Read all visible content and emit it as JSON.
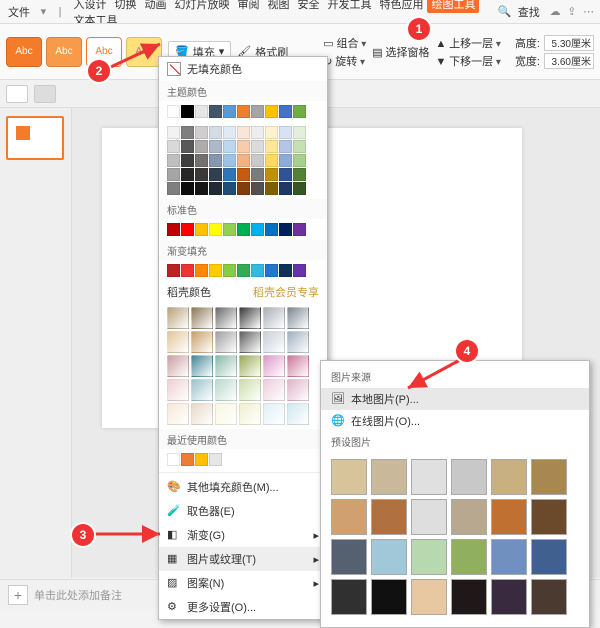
{
  "menu": {
    "file": "文件",
    "items": [
      "入设计",
      "切换",
      "动画",
      "幻灯片放映",
      "审阅",
      "视图",
      "安全",
      "开发工具",
      "特色应用",
      "绘图工具",
      "文本工具"
    ],
    "highlight_index": 9,
    "find": "查找"
  },
  "ribbon": {
    "abc": "Abc",
    "fill_label": "填充",
    "format_painter": "格式刷",
    "group": "组合",
    "rotate": "旋转",
    "select_pane": "选择窗格",
    "move_up": "上移一层",
    "move_down": "下移一层",
    "height_label": "高度:",
    "width_label": "宽度:",
    "height_value": "5.30厘米",
    "width_value": "3.60厘米"
  },
  "fillmenu": {
    "no_fill": "无填充颜色",
    "theme": "主题颜色",
    "std": "标准色",
    "grad": "渐变填充",
    "dk": "稻壳颜色",
    "dk_vip": "稻壳会员专享",
    "recent": "最近使用颜色",
    "items": {
      "more": "其他填充颜色(M)...",
      "picker": "取色器(E)",
      "gradient": "渐变(G)",
      "texture": "图片或纹理(T)",
      "pattern": "图案(N)",
      "more_settings": "更多设置(O)..."
    }
  },
  "imgsrc": {
    "src": "图片来源",
    "local": "本地图片(P)...",
    "online": "在线图片(O)...",
    "preset": "预设图片"
  },
  "bottom": {
    "hint": "单击此处添加备注"
  },
  "callouts": {
    "c1": "1",
    "c2": "2",
    "c3": "3",
    "c4": "4"
  },
  "colors": {
    "theme_row0": [
      "#ffffff",
      "#000000",
      "#e7e6e6",
      "#44546a",
      "#5b9bd5",
      "#ed7d31",
      "#a5a5a5",
      "#ffc000",
      "#4472c4",
      "#70ad47"
    ],
    "theme_shades": [
      [
        "#f2f2f2",
        "#7f7f7f",
        "#d0cece",
        "#d6dce5",
        "#deebf7",
        "#fbe5d6",
        "#ededed",
        "#fff2cc",
        "#d9e2f3",
        "#e2efda"
      ],
      [
        "#d9d9d9",
        "#595959",
        "#aeabab",
        "#adb9ca",
        "#bdd7ee",
        "#f7cbac",
        "#dbdbdb",
        "#ffe699",
        "#b4c6e7",
        "#c5e0b3"
      ],
      [
        "#bfbfbf",
        "#3f3f3f",
        "#757070",
        "#8496b0",
        "#9cc3e6",
        "#f4b183",
        "#c9c9c9",
        "#ffd965",
        "#8eaadb",
        "#a8d08d"
      ],
      [
        "#a5a5a5",
        "#262626",
        "#3a3838",
        "#323f4f",
        "#2e75b6",
        "#c55a11",
        "#7b7b7b",
        "#bf9000",
        "#2f5496",
        "#538135"
      ],
      [
        "#7f7f7f",
        "#0c0c0c",
        "#171616",
        "#222a35",
        "#1f4e79",
        "#833c0b",
        "#525252",
        "#7f6000",
        "#1f3864",
        "#375623"
      ]
    ],
    "standard": [
      "#c00000",
      "#ff0000",
      "#ffc000",
      "#ffff00",
      "#92d050",
      "#00b050",
      "#00b0f0",
      "#0070c0",
      "#002060",
      "#7030a0"
    ],
    "gradient": [
      "#b22",
      "#e33",
      "#f80",
      "#fc0",
      "#8c4",
      "#3a5",
      "#3bd",
      "#27c",
      "#135",
      "#63a"
    ],
    "dk_gradients": [
      [
        "#b9a27a",
        "#8c7a58",
        "#6c6c6c",
        "#3c3c3c",
        "#aab0b7",
        "#7d8893"
      ],
      [
        "#e4c69a",
        "#c8a06a",
        "#a0a0a0",
        "#606060",
        "#c8d0d8",
        "#a0b0c0"
      ],
      [
        "#caa0a0",
        "#448899",
        "#88bbaa",
        "#99aa55",
        "#dd99cc",
        "#cc7799"
      ],
      [
        "#f0d0d0",
        "#99c4cc",
        "#bbd8cc",
        "#ccddaa",
        "#eeccdd",
        "#e0b3c8"
      ],
      [
        "#f7e8d8",
        "#e8d8c8",
        "#f7f7e0",
        "#f0f0d0",
        "#e0f0f7",
        "#d0e8f0"
      ]
    ],
    "recent": [
      "#ffffff",
      "#ed7d31",
      "#ffc000",
      "#e7e6e6"
    ],
    "textures": [
      [
        "#d8c49a",
        "#c9b89a",
        "#e0e0e0",
        "#c8c8c8",
        "#c9b080",
        "#a88850"
      ],
      [
        "#d0a070",
        "#b07040",
        "#dedede",
        "#b8a890",
        "#c07030",
        "#6a4a2a"
      ],
      [
        "#556070",
        "#a0c8d8",
        "#b8d8b0",
        "#90b060",
        "#7090c0",
        "#406090"
      ],
      [
        "#303030",
        "#101010",
        "#e8c8a0",
        "#201818",
        "#3a2a40",
        "#4a3a30"
      ]
    ]
  }
}
